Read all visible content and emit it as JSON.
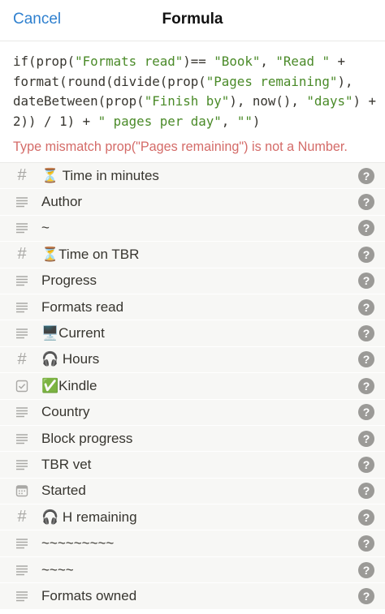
{
  "header": {
    "cancel_label": "Cancel",
    "title": "Formula"
  },
  "formula": {
    "lines": [
      [
        {
          "t": "if(prop(",
          "k": "code"
        },
        {
          "t": "\"Formats read\"",
          "k": "str"
        },
        {
          "t": ")== ",
          "k": "code"
        },
        {
          "t": "\"Book\"",
          "k": "str"
        },
        {
          "t": ", ",
          "k": "code"
        },
        {
          "t": "\"Read \"",
          "k": "str"
        },
        {
          "t": " +",
          "k": "code"
        }
      ],
      [
        {
          "t": "format(round(divide(prop(",
          "k": "code"
        },
        {
          "t": "\"Pages remaining\"",
          "k": "str"
        },
        {
          "t": "),",
          "k": "code"
        }
      ],
      [
        {
          "t": "dateBetween(prop(",
          "k": "code"
        },
        {
          "t": "\"Finish by\"",
          "k": "str"
        },
        {
          "t": "), now(), ",
          "k": "code"
        },
        {
          "t": "\"days\"",
          "k": "str"
        },
        {
          "t": ") +",
          "k": "code"
        }
      ],
      [
        {
          "t": "2)) / 1) + ",
          "k": "code"
        },
        {
          "t": "\" pages per day\"",
          "k": "str"
        },
        {
          "t": ", ",
          "k": "code"
        },
        {
          "t": "\"\"",
          "k": "str"
        },
        {
          "t": ")",
          "k": "code"
        }
      ]
    ]
  },
  "error_message": "Type mismatch prop(\"Pages remaining\") is not a Number.",
  "properties": [
    {
      "type_icon": "number-icon",
      "label": "⏳ Time in minutes"
    },
    {
      "type_icon": "text-icon",
      "label": "Author"
    },
    {
      "type_icon": "text-icon",
      "label": "~"
    },
    {
      "type_icon": "number-icon",
      "label": "⏳Time on TBR"
    },
    {
      "type_icon": "text-icon",
      "label": "Progress"
    },
    {
      "type_icon": "text-icon",
      "label": "Formats read"
    },
    {
      "type_icon": "text-icon",
      "label": "🖥️Current"
    },
    {
      "type_icon": "number-icon",
      "label": "🎧 Hours"
    },
    {
      "type_icon": "checkbox-icon",
      "label": "✅Kindle"
    },
    {
      "type_icon": "text-icon",
      "label": "Country"
    },
    {
      "type_icon": "text-icon",
      "label": "Block progress"
    },
    {
      "type_icon": "text-icon",
      "label": "TBR vet"
    },
    {
      "type_icon": "calendar-icon",
      "label": "Started"
    },
    {
      "type_icon": "number-icon",
      "label": "🎧 H remaining"
    },
    {
      "type_icon": "text-icon",
      "label": "~~~~~~~~~"
    },
    {
      "type_icon": "text-icon",
      "label": "~~~~"
    },
    {
      "type_icon": "text-icon",
      "label": "Formats owned"
    }
  ],
  "help_glyph": "?"
}
